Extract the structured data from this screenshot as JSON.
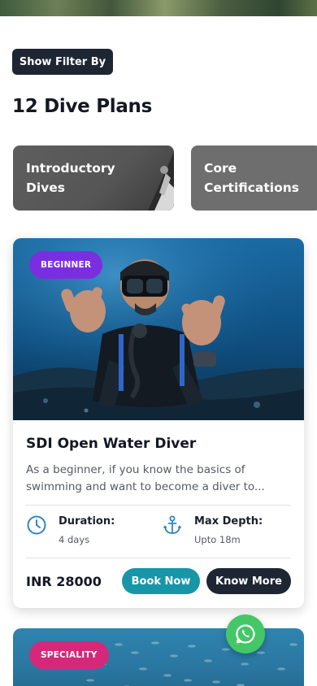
{
  "filter": {
    "button_label": "Show Filter By"
  },
  "listing": {
    "count_title": "12 Dive Plans"
  },
  "categories": [
    {
      "label": "Introductory Dives"
    },
    {
      "label": "Core Certifications"
    }
  ],
  "plans": [
    {
      "level": "BEGINNER",
      "level_color": "#7b2ee0",
      "title": "SDI Open Water Diver",
      "description": "As a beginner, if you know the basics of swimming and want to become a diver to...",
      "specs": [
        {
          "name": "Duration:",
          "value": "4 days",
          "icon": "clock-icon"
        },
        {
          "name": "Max Depth:",
          "value": "Upto 18m",
          "icon": "anchor-icon"
        }
      ],
      "price": "INR 28000",
      "book_label": "Book Now",
      "more_label": "Know More"
    },
    {
      "level": "SPECIALITY",
      "level_color": "#d6287a"
    }
  ],
  "colors": {
    "primary_dark": "#1e2533",
    "accent_teal": "#1796a8",
    "icon_blue": "#2f86c3",
    "whatsapp_green": "#44c767"
  }
}
